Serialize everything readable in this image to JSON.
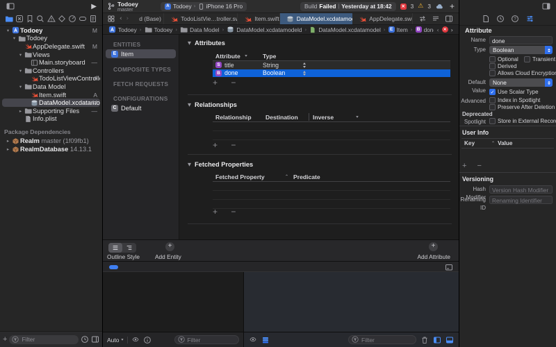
{
  "colors": {
    "selection_blue": "#0e62d8",
    "accent_blue": "#2f6fed",
    "active_tab_blue": "#3d5a7e",
    "badge_purple": "#9446c3",
    "entity_blue": "#3e73dd",
    "swift_orange": "#f05138",
    "error_red": "#e0383e",
    "warning_yellow": "#f7b733"
  },
  "toolbar": {
    "project": "Todoey",
    "branch": "master",
    "scheme_app": "Todoey",
    "scheme_device": "iPhone 16 Pro",
    "status_build": "Build",
    "status_failed": "Failed",
    "status_divider": "|",
    "status_time": "Yesterday at 18:42",
    "error_count": "3",
    "warning_count": "3"
  },
  "navigator": {
    "tree": [
      {
        "label": "Todoey",
        "icon": "app",
        "chevron": "open",
        "indent": 0,
        "badge": "M",
        "bold": true
      },
      {
        "label": "Todoey",
        "icon": "folder",
        "chevron": "open",
        "indent": 1,
        "badge": ""
      },
      {
        "label": "AppDelegate.swift",
        "icon": "swift",
        "chevron": "",
        "indent": 2,
        "badge": "M"
      },
      {
        "label": "Views",
        "icon": "folder",
        "chevron": "open",
        "indent": 2,
        "badge": ""
      },
      {
        "label": "Main.storyboard",
        "icon": "storyboard",
        "chevron": "",
        "indent": 3,
        "badge": "—"
      },
      {
        "label": "Controllers",
        "icon": "folder",
        "chevron": "open",
        "indent": 2,
        "badge": ""
      },
      {
        "label": "TodoListViewController.s…",
        "icon": "swift",
        "chevron": "",
        "indent": 3,
        "badge": "A"
      },
      {
        "label": "Data Model",
        "icon": "folder",
        "chevron": "open",
        "indent": 2,
        "badge": ""
      },
      {
        "label": "Item.swift",
        "icon": "swift",
        "chevron": "",
        "indent": 3,
        "badge": "A"
      },
      {
        "label": "DataModel.xcdatamodeld",
        "icon": "datamodel",
        "chevron": "",
        "indent": 3,
        "badge": "M",
        "selected": true
      },
      {
        "label": "Supporting Files",
        "icon": "folder",
        "chevron": "closed",
        "indent": 2,
        "badge": "—"
      },
      {
        "label": "Info.plist",
        "icon": "plist",
        "chevron": "",
        "indent": 2,
        "badge": ""
      }
    ],
    "packages_header": "Package Dependencies",
    "packages": [
      {
        "name": "Realm",
        "detail": "master (1f09fb1)"
      },
      {
        "name": "RealmDatabase",
        "detail": "14.13.1"
      }
    ],
    "filter_placeholder": "Filter"
  },
  "tabbar": {
    "tabs": [
      {
        "label": "d (Base)",
        "icon": "none",
        "active": false
      },
      {
        "label": "TodoListVie…troller.swift",
        "icon": "swift",
        "active": false
      },
      {
        "label": "Item.swift",
        "icon": "swift",
        "active": false
      },
      {
        "label": "DataModel.xcdatamodel",
        "icon": "datamodel",
        "active": true
      },
      {
        "label": "AppDelegate.swift",
        "icon": "swift",
        "active": false
      }
    ]
  },
  "breadcrumb": {
    "items": [
      {
        "label": "Todoey",
        "icon": "app"
      },
      {
        "label": "Todoey",
        "icon": "folder"
      },
      {
        "label": "Data Model",
        "icon": "folder"
      },
      {
        "label": "DataModel.xcdatamodeld",
        "icon": "datamodel"
      },
      {
        "label": "DataModel.xcdatamodel",
        "icon": "docgreen"
      },
      {
        "label": "Item",
        "icon": "badge-E"
      },
      {
        "label": "done",
        "icon": "badge-B"
      }
    ]
  },
  "entities": {
    "sections": [
      {
        "header": "ENTITIES",
        "items": [
          {
            "label": "Item",
            "badge": "E",
            "selected": true
          }
        ]
      },
      {
        "header": "COMPOSITE TYPES",
        "items": []
      },
      {
        "header": "FETCH REQUESTS",
        "items": []
      },
      {
        "header": "CONFIGURATIONS",
        "items": [
          {
            "label": "Default",
            "badge": "C",
            "selected": false
          }
        ]
      }
    ]
  },
  "attributes": {
    "title": "Attributes",
    "col_attribute": "Attribute",
    "col_type": "Type",
    "rows": [
      {
        "badge": "S",
        "name": "title",
        "type": "String",
        "selected": false
      },
      {
        "badge": "B",
        "name": "done",
        "type": "Boolean",
        "selected": true
      }
    ]
  },
  "relationships": {
    "title": "Relationships",
    "col_relationship": "Relationship",
    "col_destination": "Destination",
    "col_inverse": "Inverse"
  },
  "fetched": {
    "title": "Fetched Properties",
    "col_property": "Fetched Property",
    "col_predicate": "Predicate"
  },
  "editor_bottom": {
    "outline_style": "Outline Style",
    "add_entity": "Add Entity",
    "add_attribute": "Add Attribute"
  },
  "debug": {
    "scope": "Auto",
    "vars_filter": "Filter",
    "console_filter": "Filter"
  },
  "inspector": {
    "title": "Attribute",
    "name_label": "Name",
    "name_value": "done",
    "type_label": "Type",
    "type_value": "Boolean",
    "cb_optional": "Optional",
    "cb_transient": "Transient",
    "cb_derived": "Derived",
    "cb_cloud": "Allows Cloud Encryption",
    "default_label": "Default Value",
    "default_value": "None",
    "cb_scalar": "Use Scalar Type",
    "advanced_label": "Advanced",
    "cb_spotlight": "Index in Spotlight",
    "cb_preserve": "Preserve After Deletion",
    "deprecated_label": "Deprecated",
    "spotlight_label": "Spotlight",
    "cb_external": "Store in External Record File",
    "userinfo_title": "User Info",
    "col_key": "Key",
    "col_value": "Value",
    "versioning_title": "Versioning",
    "hash_label": "Hash Modifier",
    "hash_placeholder": "Version Hash Modifier",
    "renaming_label": "Renaming ID",
    "renaming_placeholder": "Renaming Identifier"
  }
}
